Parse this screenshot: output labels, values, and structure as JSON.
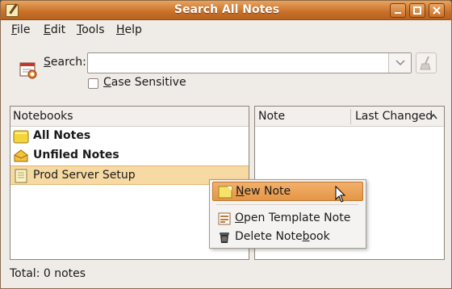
{
  "window": {
    "title": "Search All Notes"
  },
  "menubar": {
    "items": [
      {
        "label": "File",
        "mnemonic": "F",
        "rest": "ile"
      },
      {
        "label": "Edit",
        "mnemonic": "E",
        "rest": "dit"
      },
      {
        "label": "Tools",
        "mnemonic": "T",
        "rest": "ools"
      },
      {
        "label": "Help",
        "mnemonic": "H",
        "rest": "elp"
      }
    ]
  },
  "search": {
    "label_mnemonic": "S",
    "label_rest": "earch:",
    "value": "",
    "case_sensitive": {
      "mnemonic": "C",
      "rest": "ase Sensitive",
      "checked": false
    }
  },
  "notebooks": {
    "header": "Notebooks",
    "items": [
      {
        "label": "All Notes",
        "bold": true,
        "icon": "all-notes-icon"
      },
      {
        "label": "Unfiled Notes",
        "bold": true,
        "icon": "unfiled-notes-icon"
      },
      {
        "label": "Prod Server Setup",
        "bold": false,
        "icon": "notebook-icon",
        "selected": true
      }
    ]
  },
  "notes": {
    "col_note": "Note",
    "col_changed": "Last Changed"
  },
  "status": {
    "total": "Total: 0 notes"
  },
  "context_menu": {
    "items": [
      {
        "label": "New Note",
        "pre": "",
        "mnemonic": "N",
        "post": "ew Note",
        "icon": "new-note-icon",
        "highlighted": true
      },
      {
        "label": "Open Template Note",
        "pre": "",
        "mnemonic": "O",
        "post": "pen Template Note",
        "icon": "template-note-icon"
      },
      {
        "label": "Delete Notebook",
        "pre": "Delete Note",
        "mnemonic": "b",
        "post": "ook",
        "icon": "trash-icon"
      }
    ]
  },
  "colors": {
    "titlebar": "#c8702a",
    "selection": "#f7d9a3",
    "menu_highlight": "#e49646"
  }
}
